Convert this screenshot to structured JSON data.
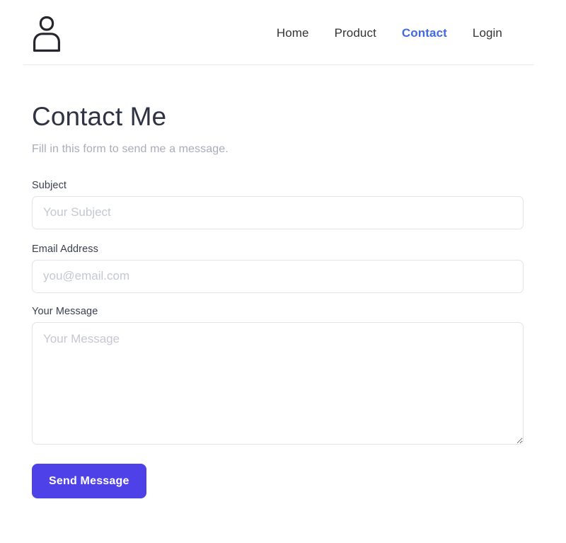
{
  "header": {
    "logo_icon": "user-avatar-icon",
    "nav": [
      {
        "label": "Home",
        "active": false
      },
      {
        "label": "Product",
        "active": false
      },
      {
        "label": "Contact",
        "active": true
      },
      {
        "label": "Login",
        "active": false
      }
    ]
  },
  "main": {
    "title": "Contact Me",
    "subtitle": "Fill in this form to send me a message."
  },
  "form": {
    "subject": {
      "label": "Subject",
      "placeholder": "Your Subject",
      "value": ""
    },
    "email": {
      "label": "Email Address",
      "placeholder": "you@email.com",
      "value": ""
    },
    "message": {
      "label": "Your Message",
      "placeholder": "Your Message",
      "value": ""
    },
    "submit_label": "Send Message"
  },
  "colors": {
    "accent_link": "#4169e1",
    "button_bg": "#4f41e8",
    "heading": "#2f3342",
    "subtitle": "#a9adbb",
    "label": "#3a3f4f",
    "placeholder": "#c5c8d2",
    "border": "#e3e3e9",
    "rule": "#e9e9ec"
  }
}
